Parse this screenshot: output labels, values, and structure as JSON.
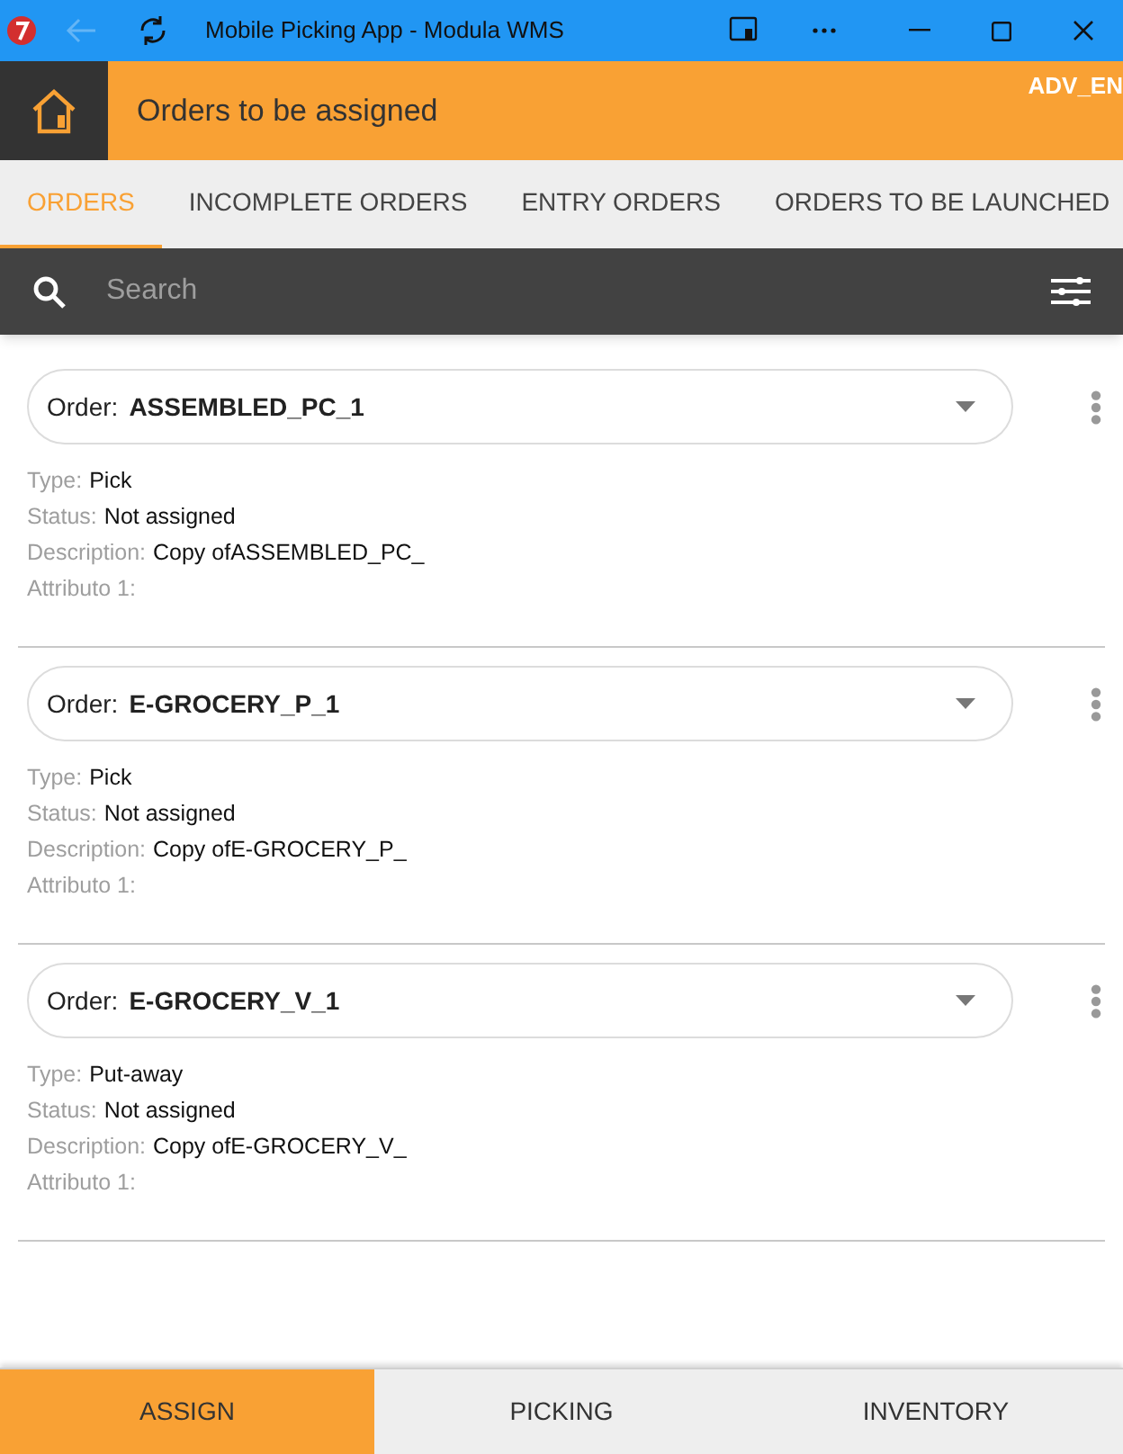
{
  "window": {
    "title": "Mobile Picking App - Modula WMS"
  },
  "header": {
    "title": "Orders to be assigned",
    "user": "ADV_EN"
  },
  "tabs": [
    {
      "label": "ORDERS",
      "selected": true
    },
    {
      "label": "INCOMPLETE ORDERS",
      "selected": false
    },
    {
      "label": "ENTRY ORDERS",
      "selected": false
    },
    {
      "label": "ORDERS TO BE LAUNCHED",
      "selected": false
    }
  ],
  "search": {
    "placeholder": "Search"
  },
  "orders": [
    {
      "order_label": "Order:",
      "order": "ASSEMBLED_PC_1",
      "fields": [
        {
          "label": "Type:",
          "value": "Pick"
        },
        {
          "label": "Status:",
          "value": "Not assigned"
        },
        {
          "label": "Description:",
          "value": "Copy ofASSEMBLED_PC_"
        },
        {
          "label": "Attributo 1:"
        }
      ]
    },
    {
      "order_label": "Order:",
      "order": "E-GROCERY_P_1",
      "fields": [
        {
          "label": "Type:",
          "value": "Pick"
        },
        {
          "label": "Status:",
          "value": "Not assigned"
        },
        {
          "label": "Description:",
          "value": "Copy ofE-GROCERY_P_"
        },
        {
          "label": "Attributo 1:"
        }
      ]
    },
    {
      "order_label": "Order:",
      "order": "E-GROCERY_V_1",
      "fields": [
        {
          "label": "Type:",
          "value": "Put-away"
        },
        {
          "label": "Status:",
          "value": "Not assigned"
        },
        {
          "label": "Description:",
          "value": "Copy ofE-GROCERY_V_"
        },
        {
          "label": "Attributo 1:"
        }
      ]
    }
  ],
  "bottom_nav": [
    {
      "label": "ASSIGN",
      "selected": true
    },
    {
      "label": "PICKING",
      "selected": false
    },
    {
      "label": "INVENTORY",
      "selected": false
    }
  ]
}
